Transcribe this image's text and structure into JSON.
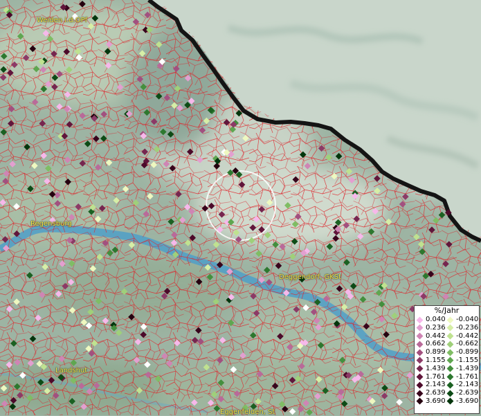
{
  "cities": [
    {
      "name": "Weiden i.d.OPf"
    },
    {
      "name": "Regensburg"
    },
    {
      "name": "Deggendorf, GKSt"
    },
    {
      "name": "Landshut"
    },
    {
      "name": "Eggenfelden, St"
    }
  ],
  "legend": {
    "title": "%/Jahr",
    "rows": [
      {
        "pos": "0.040",
        "neg": "-0.040",
        "pos_color": "#f6b8ea",
        "neg_color": "#eef8c0"
      },
      {
        "pos": "0.236",
        "neg": "-0.236",
        "pos_color": "#e39fd0",
        "neg_color": "#d6eea6"
      },
      {
        "pos": "0.442",
        "neg": "-0.442",
        "pos_color": "#cf85b4",
        "neg_color": "#bfe290"
      },
      {
        "pos": "0.662",
        "neg": "-0.662",
        "pos_color": "#b96a99",
        "neg_color": "#9fd07a"
      },
      {
        "pos": "0.899",
        "neg": "-0.899",
        "pos_color": "#a2507f",
        "neg_color": "#7fbd64"
      },
      {
        "pos": "1.155",
        "neg": "-1.155",
        "pos_color": "#8c3a66",
        "neg_color": "#5fa650"
      },
      {
        "pos": "1.439",
        "neg": "-1.439",
        "pos_color": "#76264f",
        "neg_color": "#448f3e"
      },
      {
        "pos": "1.761",
        "neg": "-1.761",
        "pos_color": "#61163b",
        "neg_color": "#2d782f"
      },
      {
        "pos": "2.143",
        "neg": "-2.143",
        "pos_color": "#4c0a2a",
        "neg_color": "#1b6122"
      },
      {
        "pos": "2.639",
        "neg": "-2.639",
        "pos_color": "#38041c",
        "neg_color": "#0d4b16"
      },
      {
        "pos": "3.690",
        "neg": "-3.690",
        "pos_color": "#25000f",
        "neg_color": "#03350c"
      }
    ]
  }
}
